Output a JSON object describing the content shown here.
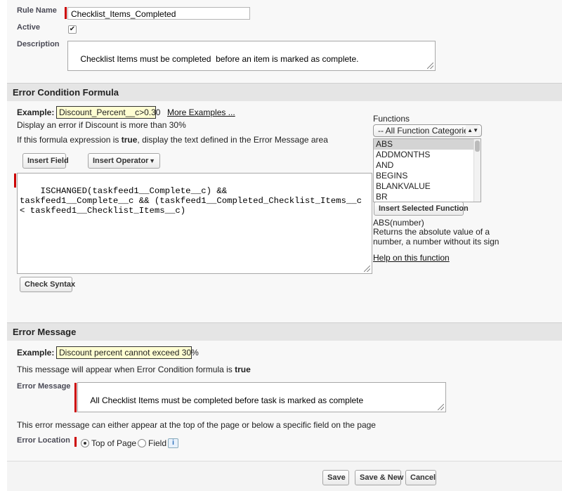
{
  "rule": {
    "name_label": "Rule Name",
    "name_value": "Checklist_Items_Completed",
    "active_label": "Active",
    "active_checked": "✔",
    "description_label": "Description",
    "description_value": "Checklist Items must be completed  before an item is marked as complete."
  },
  "error_condition": {
    "section_title": "Error Condition Formula",
    "example_label": "Example:",
    "example_value": "Discount_Percent__c>0.30",
    "more_examples": "More Examples ...",
    "display_line": "Display an error if Discount is more than 30%",
    "hint_prefix": "If this formula expression is ",
    "hint_bold": "true",
    "hint_suffix": ", display the text defined in the Error Message area",
    "insert_field": "Insert Field",
    "insert_operator": "Insert Operator",
    "formula": "ISCHANGED(taskfeed1__Complete__c) &&\ntaskfeed1__Complete__c && (taskfeed1__Completed_Checklist_Items__c\n< taskfeed1__Checklist_Items__c)",
    "check_syntax": "Check Syntax"
  },
  "functions": {
    "label": "Functions",
    "category_selected": "-- All Function Categorie",
    "items": [
      "ABS",
      "ADDMONTHS",
      "AND",
      "BEGINS",
      "BLANKVALUE",
      "BR"
    ],
    "insert_selected": "Insert Selected Function",
    "signature": "ABS(number)",
    "description": "Returns the absolute value of a number, a number without its sign",
    "help_link": "Help on this function"
  },
  "error_message": {
    "section_title": "Error Message",
    "example_label": "Example:",
    "example_value": "Discount percent cannot exceed 30%",
    "appear_prefix": "This message will appear when Error Condition formula is ",
    "appear_bold": "true",
    "message_label": "Error Message",
    "message_value": "All Checklist Items must be completed before task is marked as complete",
    "location_hint": "This error message can either appear at the top of the page or below a specific field on the page",
    "location_label": "Error Location",
    "opt_top": "Top of Page",
    "opt_field": "Field",
    "info_glyph": "i"
  },
  "footer": {
    "save": "Save",
    "save_new": "Save & New",
    "cancel": "Cancel"
  }
}
